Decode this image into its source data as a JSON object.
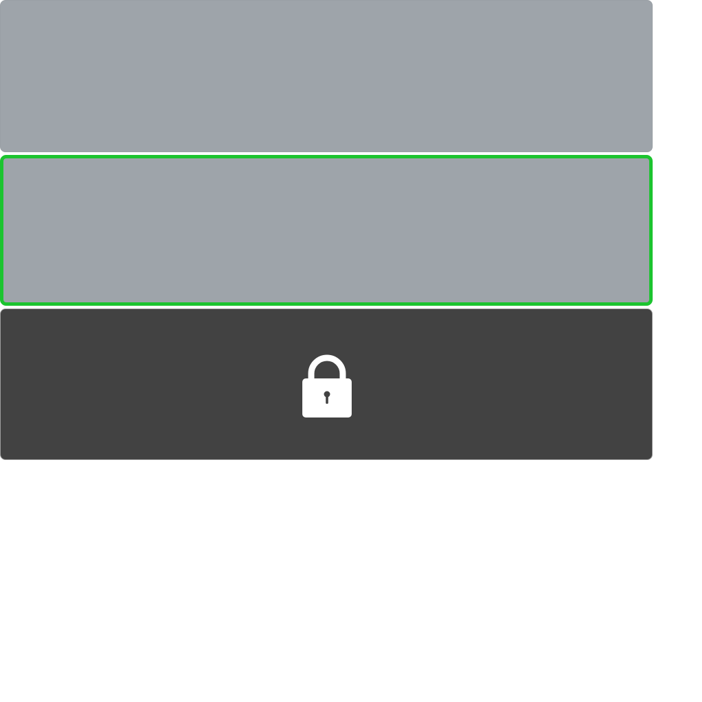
{
  "colors": {
    "page_background": "#ffffff",
    "tile_gray": "#9ea4aa",
    "tile_locked": "#424242",
    "selection_outline": "#1cc42f",
    "lock_icon": "#ffffff"
  },
  "tiles": [
    {
      "state": "unlocked",
      "selected": false
    },
    {
      "state": "unlocked",
      "selected": true
    },
    {
      "state": "locked",
      "selected": false,
      "icon": "lock-icon"
    }
  ]
}
